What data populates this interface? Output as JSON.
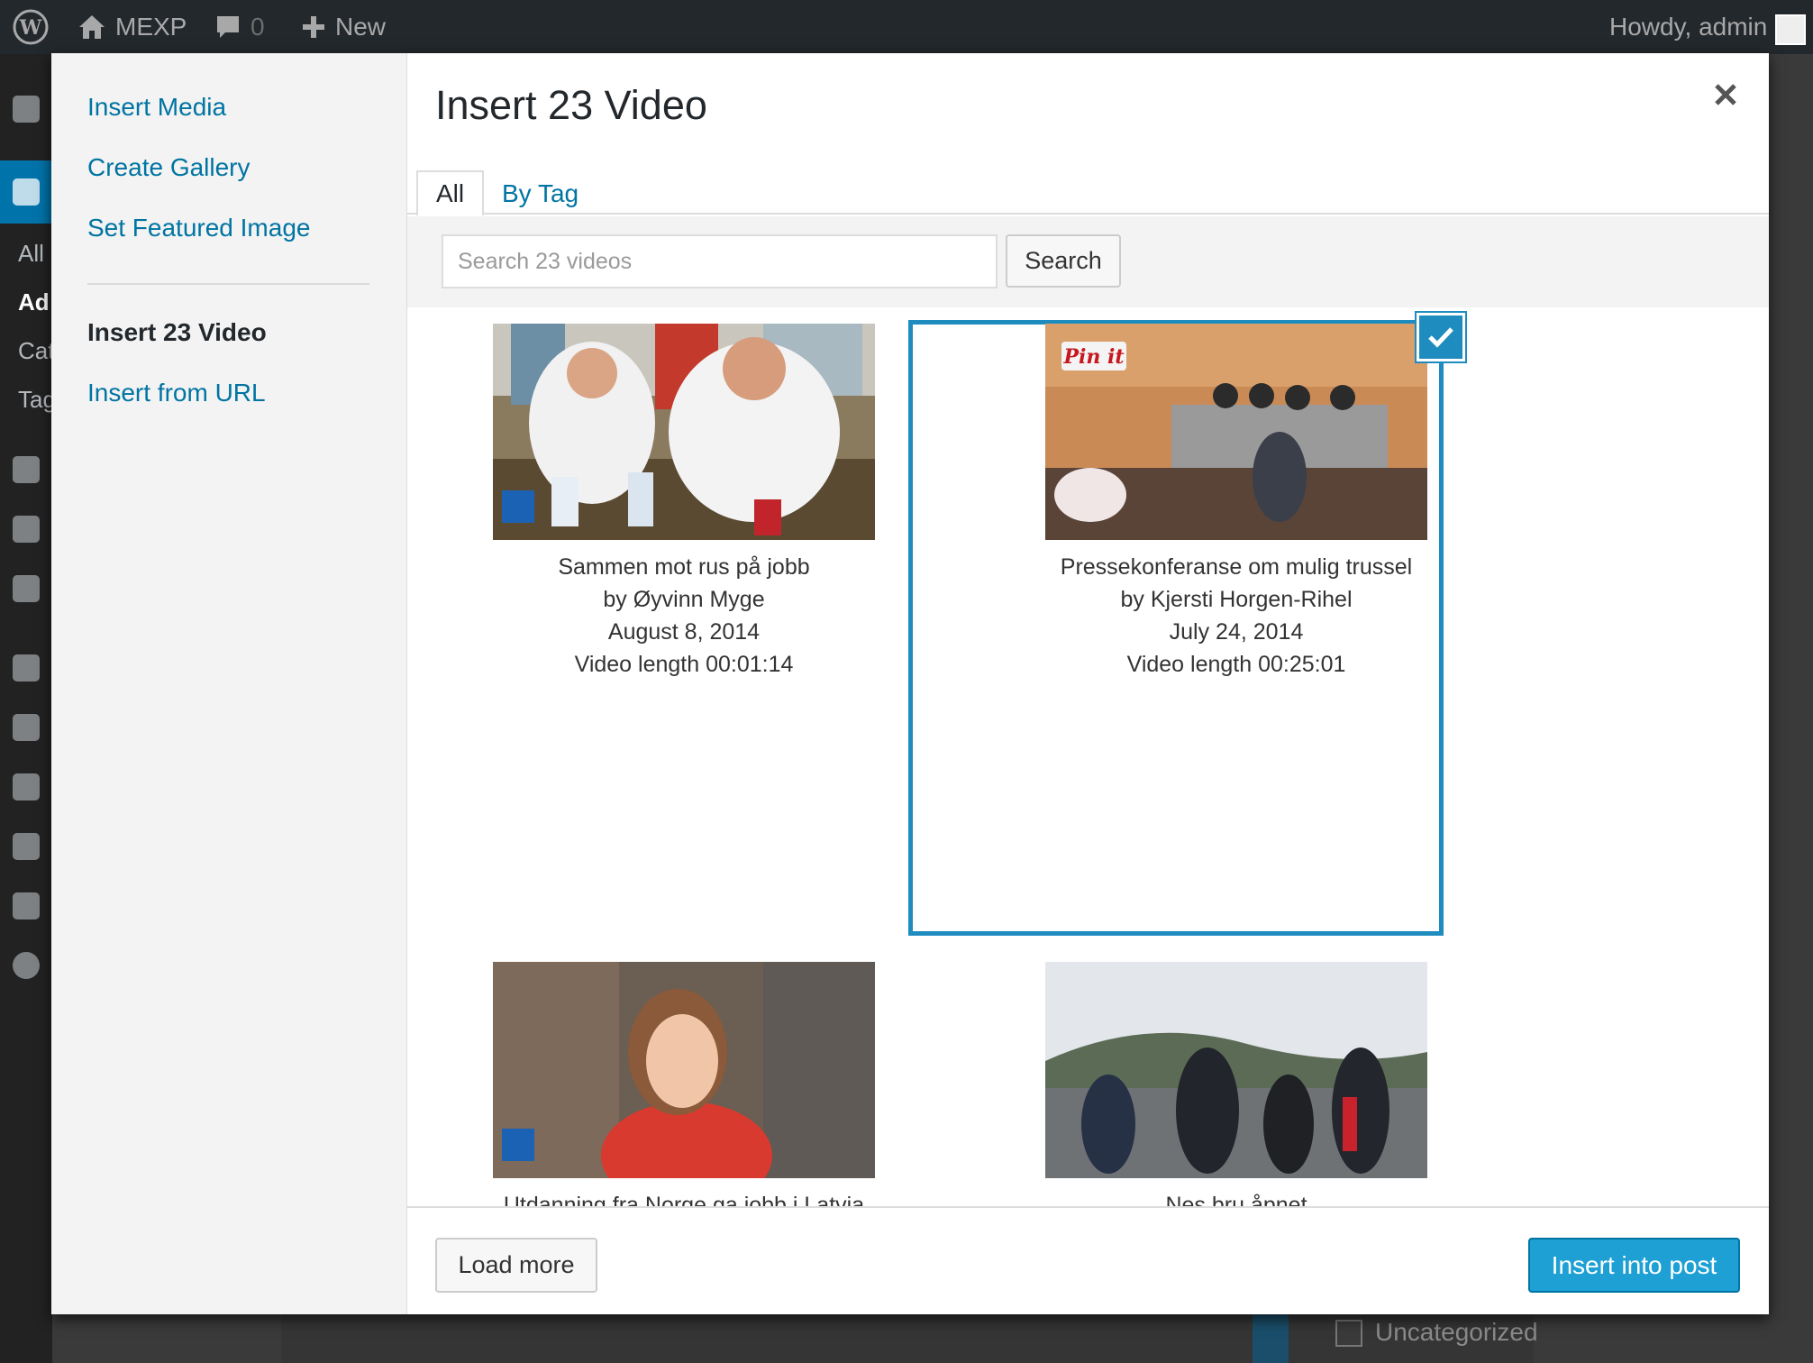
{
  "admin_bar": {
    "site_name": "MEXP",
    "comments_count": "0",
    "new_label": "New",
    "greeting": "Howdy, admin"
  },
  "background": {
    "menu_subitems": [
      "All",
      "Ad",
      "Cat",
      "Tag"
    ],
    "category_label": "Uncategorized"
  },
  "modal": {
    "title": "Insert 23 Video",
    "menu": {
      "items": [
        {
          "label": "Insert Media"
        },
        {
          "label": "Create Gallery"
        },
        {
          "label": "Set Featured Image"
        },
        {
          "label": "Insert 23 Video"
        },
        {
          "label": "Insert from URL"
        }
      ]
    },
    "tabs": [
      {
        "label": "All"
      },
      {
        "label": "By Tag"
      }
    ],
    "search": {
      "placeholder": "Search 23 videos",
      "button_label": "Search"
    },
    "videos": [
      {
        "title": "Sammen mot rus på jobb",
        "author": "by Øyvinn Myge",
        "date": "August 8, 2014",
        "length": "Video length 00:01:14",
        "selected": false
      },
      {
        "title": "Pressekonferanse om mulig trussel",
        "author": "by Kjersti Horgen-Rihel",
        "date": "July 24, 2014",
        "length": "Video length 00:25:01",
        "selected": true
      },
      {
        "title": "Utdanning fra Norge ga jobb i Latvia",
        "author": "",
        "date": "",
        "length": "",
        "selected": false
      },
      {
        "title": "Nes bru åpnet",
        "author": "",
        "date": "",
        "length": "",
        "selected": false
      }
    ],
    "pin_badge": "Pin it",
    "footer": {
      "load_more": "Load more",
      "insert_button": "Insert into post"
    }
  },
  "colors": {
    "accent": "#1e8cbe",
    "primary_button": "#1ea0d5",
    "link": "#0074a2"
  }
}
